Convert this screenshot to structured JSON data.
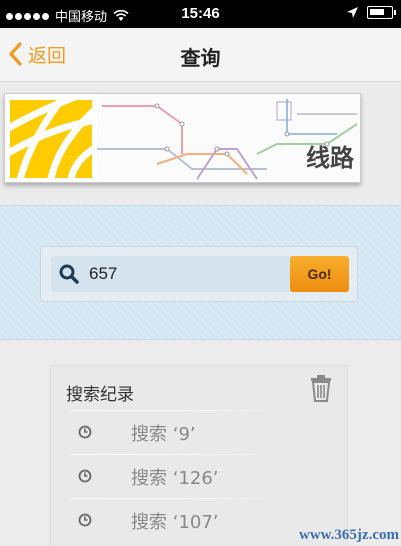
{
  "status_bar": {
    "carrier": "中国移动",
    "time": "15:46"
  },
  "nav": {
    "back_label": "返回",
    "title": "查询"
  },
  "banner": {
    "title": "线路"
  },
  "search": {
    "value": "657",
    "go_label": "Go!"
  },
  "history": {
    "title": "搜索纪录",
    "items": [
      {
        "label": "搜索 ‘9’"
      },
      {
        "label": "搜索 ‘126’"
      },
      {
        "label": "搜索 ‘107’"
      }
    ]
  },
  "watermark": "www.365jz.com",
  "colors": {
    "accent": "#f29a1e",
    "search_bg": "#d3e6f3",
    "go_button": "#f5a623"
  }
}
